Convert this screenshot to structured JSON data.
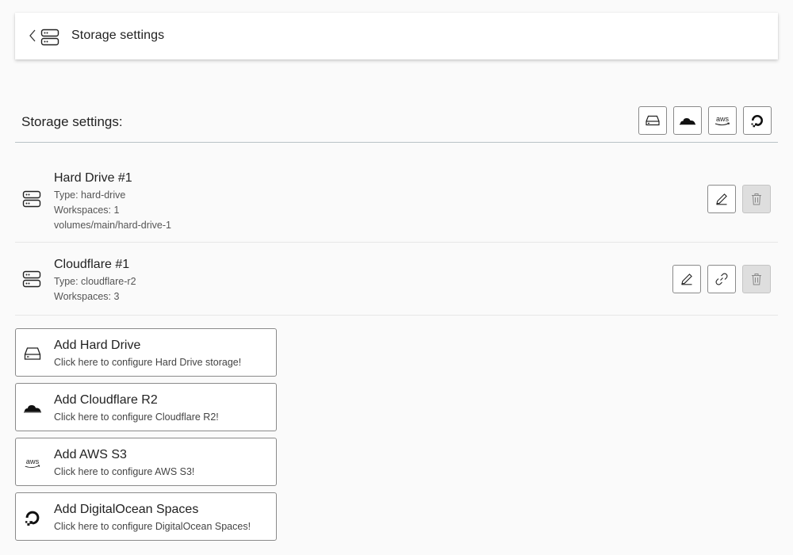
{
  "header": {
    "title": "Storage settings",
    "back_icon": "chevron-left-icon",
    "icon": "server-icon"
  },
  "section": {
    "title": "Storage settings:",
    "providers": [
      {
        "name": "hard-drive-icon"
      },
      {
        "name": "cloudflare-icon"
      },
      {
        "name": "aws-icon"
      },
      {
        "name": "digitalocean-icon"
      }
    ]
  },
  "storages": [
    {
      "title": "Hard Drive #1",
      "type": "Type: hard-drive",
      "workspaces": "Workspaces: 1",
      "path": "volumes/main/hard-drive-1",
      "actions": [
        "edit",
        "delete"
      ]
    },
    {
      "title": "Cloudflare #1",
      "type": "Type: cloudflare-r2",
      "workspaces": "Workspaces: 3",
      "actions": [
        "edit",
        "link",
        "delete"
      ]
    }
  ],
  "add_options": [
    {
      "title": "Add Hard Drive",
      "subtitle": "Click here to configure Hard Drive storage!",
      "icon": "hard-drive-icon"
    },
    {
      "title": "Add Cloudflare R2",
      "subtitle": "Click here to configure Cloudflare R2!",
      "icon": "cloudflare-icon"
    },
    {
      "title": "Add AWS S3",
      "subtitle": "Click here to configure AWS S3!",
      "icon": "aws-icon"
    },
    {
      "title": "Add DigitalOcean Spaces",
      "subtitle": "Click here to configure DigitalOcean Spaces!",
      "icon": "digitalocean-icon"
    }
  ],
  "colors": {
    "background": "#fafafa",
    "card": "#ffffff",
    "border": "#8a8a8a",
    "disabled": "#dedede",
    "divider": "#b9c2c6"
  }
}
